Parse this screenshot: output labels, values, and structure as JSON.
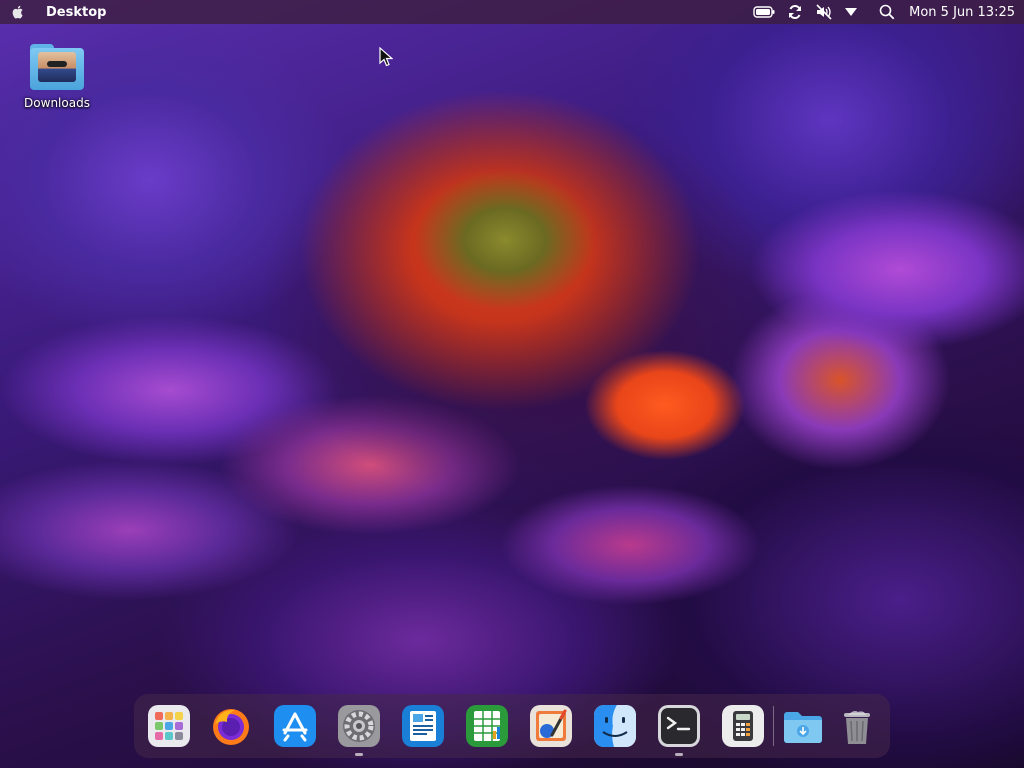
{
  "topbar": {
    "apple_icon": "apple-icon",
    "app_title": "Desktop",
    "tray_icons": [
      "battery-icon",
      "sync-icon",
      "muted-speaker-icon",
      "menu-arrow-icon",
      "search-icon"
    ],
    "clock": "Mon 5 Jun 13:25"
  },
  "desktop": {
    "icons": [
      {
        "label": "Downloads",
        "icon": "folder-icon"
      }
    ]
  },
  "dock": {
    "items": [
      {
        "name": "launchpad",
        "icon": "launchpad-icon",
        "running": false
      },
      {
        "name": "firefox",
        "icon": "firefox-icon",
        "running": false
      },
      {
        "name": "app-store",
        "icon": "app-store-icon",
        "running": false
      },
      {
        "name": "system-preferences",
        "icon": "gear-icon",
        "running": true
      },
      {
        "name": "text-editor",
        "icon": "document-icon",
        "running": false
      },
      {
        "name": "spreadsheet",
        "icon": "spreadsheet-icon",
        "running": false
      },
      {
        "name": "image-editor",
        "icon": "paint-icon",
        "running": false
      },
      {
        "name": "finder",
        "icon": "finder-icon",
        "running": false
      },
      {
        "name": "terminal",
        "icon": "terminal-icon",
        "running": true
      },
      {
        "name": "calculator",
        "icon": "calculator-icon",
        "running": false
      },
      {
        "name": "downloads-folder",
        "icon": "download-folder-icon",
        "running": false
      },
      {
        "name": "trash",
        "icon": "trash-icon",
        "running": false
      }
    ]
  },
  "colors": {
    "topbar_bg": "#3c1e3c",
    "dock_bg": "#46284b",
    "folder_blue": "#5fb3e6"
  }
}
